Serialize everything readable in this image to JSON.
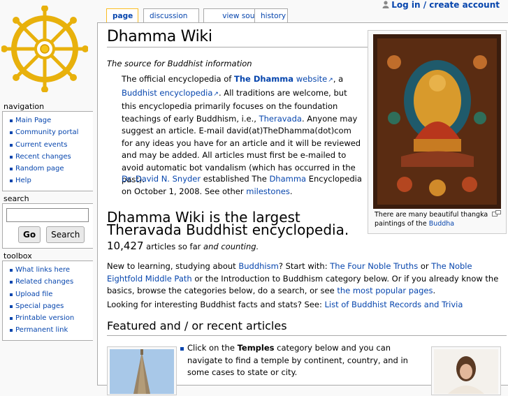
{
  "personal": {
    "login_label": "Log in / create account"
  },
  "tabs": [
    {
      "label": "page"
    },
    {
      "label": "discussion"
    },
    {
      "label": "view source"
    },
    {
      "label": "history"
    }
  ],
  "navigation": {
    "title": "navigation",
    "items": [
      "Main Page",
      "Community portal",
      "Current events",
      "Recent changes",
      "Random page",
      "Help"
    ]
  },
  "search": {
    "title": "search",
    "go_label": "Go",
    "search_label": "Search"
  },
  "toolbox": {
    "title": "toolbox",
    "items": [
      "What links here",
      "Related changes",
      "Upload file",
      "Special pages",
      "Printable version",
      "Permanent link"
    ]
  },
  "content": {
    "title": "Dhamma Wiki",
    "tagline": "The source for Buddhist information",
    "intro": {
      "t1": "The official encyclopedia of ",
      "link_dhamma": "The Dhamma",
      "link_website": "website",
      "t2": ", a ",
      "link_encyclopedia": "Buddhist encyclopedia",
      "t3": ". All traditions are welcome, but this encyclopedia primarily focuses on the foundation teachings of early Buddhism, i.e., ",
      "link_theravada": "Theravada",
      "t4": ". Anyone may suggest an article. E-mail david(at)TheDhamma(dot)com for any ideas you have for an article and it will be reviewed and may be added. All articles must first be e-mailed to avoid automatic bot vandalism (which has occurred in the past)."
    },
    "intro2": {
      "link_snyder": "Dr. David N. Snyder",
      "t1": " established The ",
      "link_dhamma": "Dhamma",
      "t2": " Encyclopedia on October 1, 2008. See other ",
      "link_milestones": "milestones",
      "t3": "."
    },
    "thumb_caption": {
      "t1": "There are many beautiful thangka paintings of the ",
      "link": "Buddha"
    },
    "big_heading": "Dhamma Wiki is the largest Theravada Buddhist encyclopedia.",
    "count": {
      "number": "10,427",
      "t1": " articles so far ",
      "t2": "and counting."
    },
    "para1": {
      "t1": "New to learning, studying about ",
      "link_buddhism": "Buddhism",
      "t2": "? Start with: ",
      "link_truths": "The Four Noble Truths",
      "t3": " or ",
      "link_path": "The Noble Eightfold Middle Path",
      "t4": " or the Introduction to Buddhism category below. Or if you already know the basics, browse the categories below, do a search, or see ",
      "link_popular": "the most popular pages",
      "t5": "."
    },
    "para2": {
      "t1": "Looking for interesting Buddhist facts and stats? See: ",
      "link": "List of Buddhist Records and Trivia"
    },
    "featured_heading": "Featured and / or recent articles",
    "temples": {
      "t1": "Click on the ",
      "bold": "Temples",
      "t2": " category below and you can navigate to find a temple by continent, country, and in some cases to state or city."
    }
  },
  "colors": {
    "link": "#0645ad",
    "tab_selected_border": "#fabd23",
    "logo_gold": "#e8b10c"
  },
  "icons": [
    "dharma-wheel-logo",
    "user-icon",
    "external-link-icon",
    "magnify-icon"
  ]
}
